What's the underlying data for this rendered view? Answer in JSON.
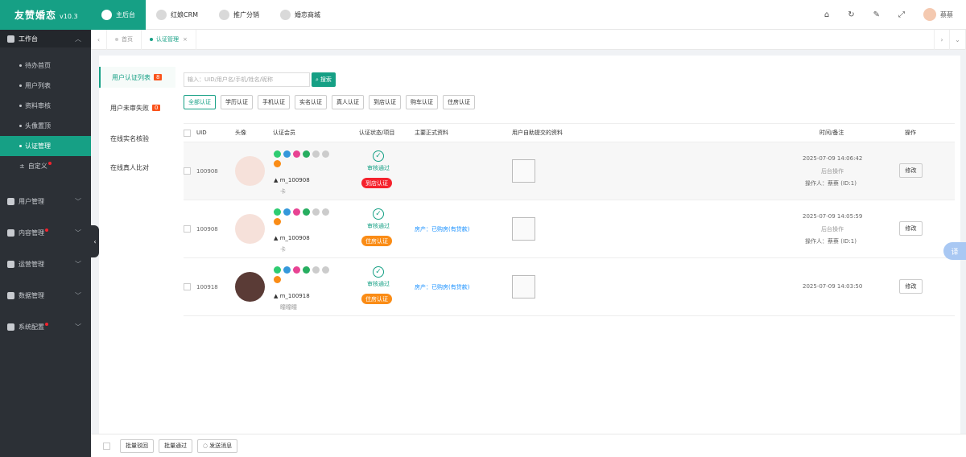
{
  "app": {
    "title": "友赞婚恋",
    "version": "v10.3"
  },
  "topnav": [
    {
      "label": "主后台"
    },
    {
      "label": "红娘CRM"
    },
    {
      "label": "推广分销"
    },
    {
      "label": "婚恋商城"
    }
  ],
  "user": {
    "name": "蔡蔡"
  },
  "sidebar": {
    "group": "工作台",
    "items": [
      {
        "label": "待办首页"
      },
      {
        "label": "用户列表"
      },
      {
        "label": "资料审核"
      },
      {
        "label": "头像置顶"
      },
      {
        "label": "认证管理"
      },
      {
        "label": "自定义"
      }
    ],
    "sections": [
      {
        "label": "用户管理"
      },
      {
        "label": "内容管理"
      },
      {
        "label": "运营管理"
      },
      {
        "label": "数据管理"
      },
      {
        "label": "系统配置"
      }
    ]
  },
  "tabs": [
    {
      "label": "首页"
    },
    {
      "label": "认证管理"
    }
  ],
  "leftnav": [
    {
      "label": "用户认证列表",
      "count": "8"
    },
    {
      "label": "用户未审失败",
      "count": "0"
    },
    {
      "label": "在线实名核验"
    },
    {
      "label": "在线真人比对"
    }
  ],
  "search": {
    "placeholder": "输入：UID/用户名/手机/姓名/昵称",
    "button": "搜索"
  },
  "filters": [
    "全部认证",
    "学历认证",
    "手机认证",
    "实名认证",
    "真人认证",
    "到店认证",
    "购车认证",
    "住房认证"
  ],
  "columns": {
    "uid": "UID",
    "avatar": "头像",
    "member": "认证会员",
    "status": "认证状态/项目",
    "main": "主要正式资料",
    "submitted": "用户自助提交的资料",
    "time": "时间/备注",
    "op": "操作"
  },
  "rows": [
    {
      "uid": "100908",
      "name": "m_100908",
      "sub": "卡",
      "status": "审核通过",
      "tag": "到店认证",
      "tag_color": "#f5222d",
      "main": "",
      "time": "2025-07-09 14:06:42",
      "note": "后台操作",
      "operator": "操作人：蔡蔡 (ID:1)",
      "edit": "修改"
    },
    {
      "uid": "100908",
      "name": "m_100908",
      "sub": "卡",
      "status": "审核通过",
      "tag": "住房认证",
      "tag_color": "#fa8c16",
      "main": "房产：已购房(有贷款)",
      "time": "2025-07-09 14:05:59",
      "note": "后台操作",
      "operator": "操作人：蔡蔡 (ID:1)",
      "edit": "修改"
    },
    {
      "uid": "100918",
      "name": "m_100918",
      "sub": "瞳瞳瞳",
      "status": "审核通过",
      "tag": "住房认证",
      "tag_color": "#fa8c16",
      "main": "房产：已购房(有贷款)",
      "time": "2025-07-09 14:03:50",
      "note": "",
      "operator": "",
      "edit": "修改"
    }
  ],
  "bottom": {
    "reject": "批量驳回",
    "approve": "批量通过",
    "message": "发送消息"
  },
  "translate": "译"
}
